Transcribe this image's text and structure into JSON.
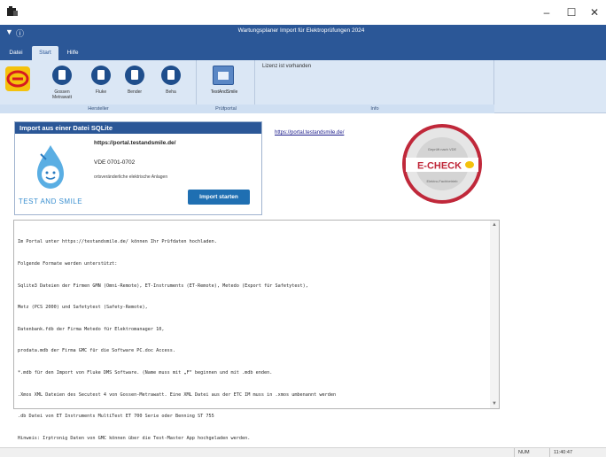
{
  "window": {
    "title": "Wartungsplaner Import für Elektroprüfungen 2024",
    "controls": {
      "minimize": "–",
      "maximize": "☐",
      "close": "✕"
    }
  },
  "quick_access": {
    "dropdown": "▼",
    "info": "ⓘ"
  },
  "tabs": [
    {
      "label": "Datei"
    },
    {
      "label": "Start"
    },
    {
      "label": "Hilfe"
    }
  ],
  "ribbon": {
    "groups": {
      "hersteller": "Hersteller",
      "pruefportal": "Prüfportal",
      "info": "Info"
    },
    "buttons": [
      {
        "label": "Gossen Metrawatt"
      },
      {
        "label": "Fluke"
      },
      {
        "label": "Bender"
      },
      {
        "label": "Beha"
      }
    ],
    "portal_button": {
      "label": "TestAndSmile"
    },
    "info_text": "Lizenz ist vorhanden"
  },
  "import_card": {
    "header": "Import aus einer Datei SQLite",
    "url": "https://portal.testandsmile.de/",
    "vde": "VDE 0701-0702",
    "description": "ortsveränderliche elektrische Anlagen",
    "button": "Import starten",
    "logo_text": "TEST AND SMILE"
  },
  "portal_link": "https://portal.testandsmile.de/",
  "echeck": {
    "title": "E-CHECK",
    "ring_top": "Geprüft nach VDE",
    "ring_bottom": "Elektro-Fachbetrieb"
  },
  "text_content": [
    "Im Portal unter https://testandsmile.de/ können Ihr Prüfdaten hochladen.",
    "Folgende Formate werden unterstützt:",
    "Sqlite3 Dateien der Firmen GMN (Omni-Remote), ET-Instruments (ET-Remote), Metedo (Export für Safetytest),",
    "Metz (PCS 2000) und Safetytest (Safety-Remote),",
    "Datenbank.fdb der Firma Metedo für Elektromanager 10,",
    "prodata.mdb der Firma GMC für die Software PC.doc Access.",
    "*.mdb für den Import von Fluke DMS Software. (Name muss mit „F“ beginnen und mit .mdb enden.",
    ".Xmos XML Dateien des Secutest 4 von Gossen-Metrawatt. Eine XML Datei aus der ETC IM muss in .xmos umbenannt werden",
    ".db Datei von ET Instruments MultiTest ET 700 Serie oder Benning ST 755",
    "Hinweis: Irptronig Daten von GMC können über die Test-Master App hochgeladen werden."
  ],
  "statusbar": {
    "num": "NUM",
    "time": "11:40:47"
  },
  "colors": {
    "brand_blue": "#2b5797",
    "ribbon_bg": "#dbe7f5",
    "echeck_red": "#c0283a",
    "logo_yellow": "#f4c20d"
  }
}
